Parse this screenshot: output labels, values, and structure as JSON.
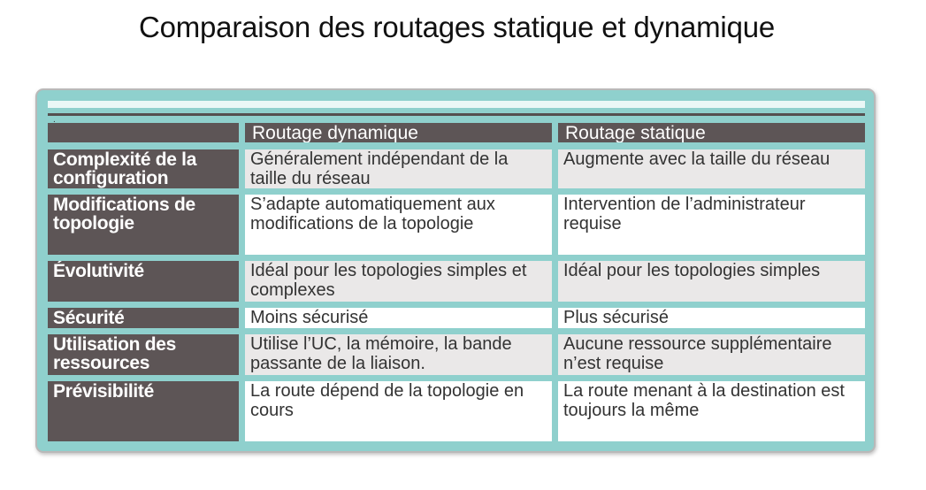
{
  "title": "Comparaison des routages statique et dynamique",
  "table": {
    "header_marker": ".",
    "columns": [
      "Routage dynamique",
      "Routage statique"
    ],
    "rows": [
      {
        "label": "Complexité de la configuration",
        "dynamic": "Généralement indépendant de la taille du réseau",
        "static": "Augmente avec la taille du réseau"
      },
      {
        "label": "Modifications de topologie",
        "dynamic": "S’adapte automatiquement aux modifications de la topologie",
        "static": "Intervention de l’administrateur requise"
      },
      {
        "label": "Évolutivité",
        "dynamic": "Idéal pour les topologies simples et complexes",
        "static": "Idéal pour les topologies simples"
      },
      {
        "label": "Sécurité",
        "dynamic": "Moins sécurisé",
        "static": "Plus sécurisé"
      },
      {
        "label": "Utilisation des ressources",
        "dynamic": "Utilise l’UC, la mémoire, la bande passante de la liaison.",
        "static": "Aucune ressource supplémentaire n’est requise"
      },
      {
        "label": "Prévisibilité",
        "dynamic": "La route dépend de la topologie en cours",
        "static": "La route menant à la destination est toujours la même"
      }
    ]
  }
}
